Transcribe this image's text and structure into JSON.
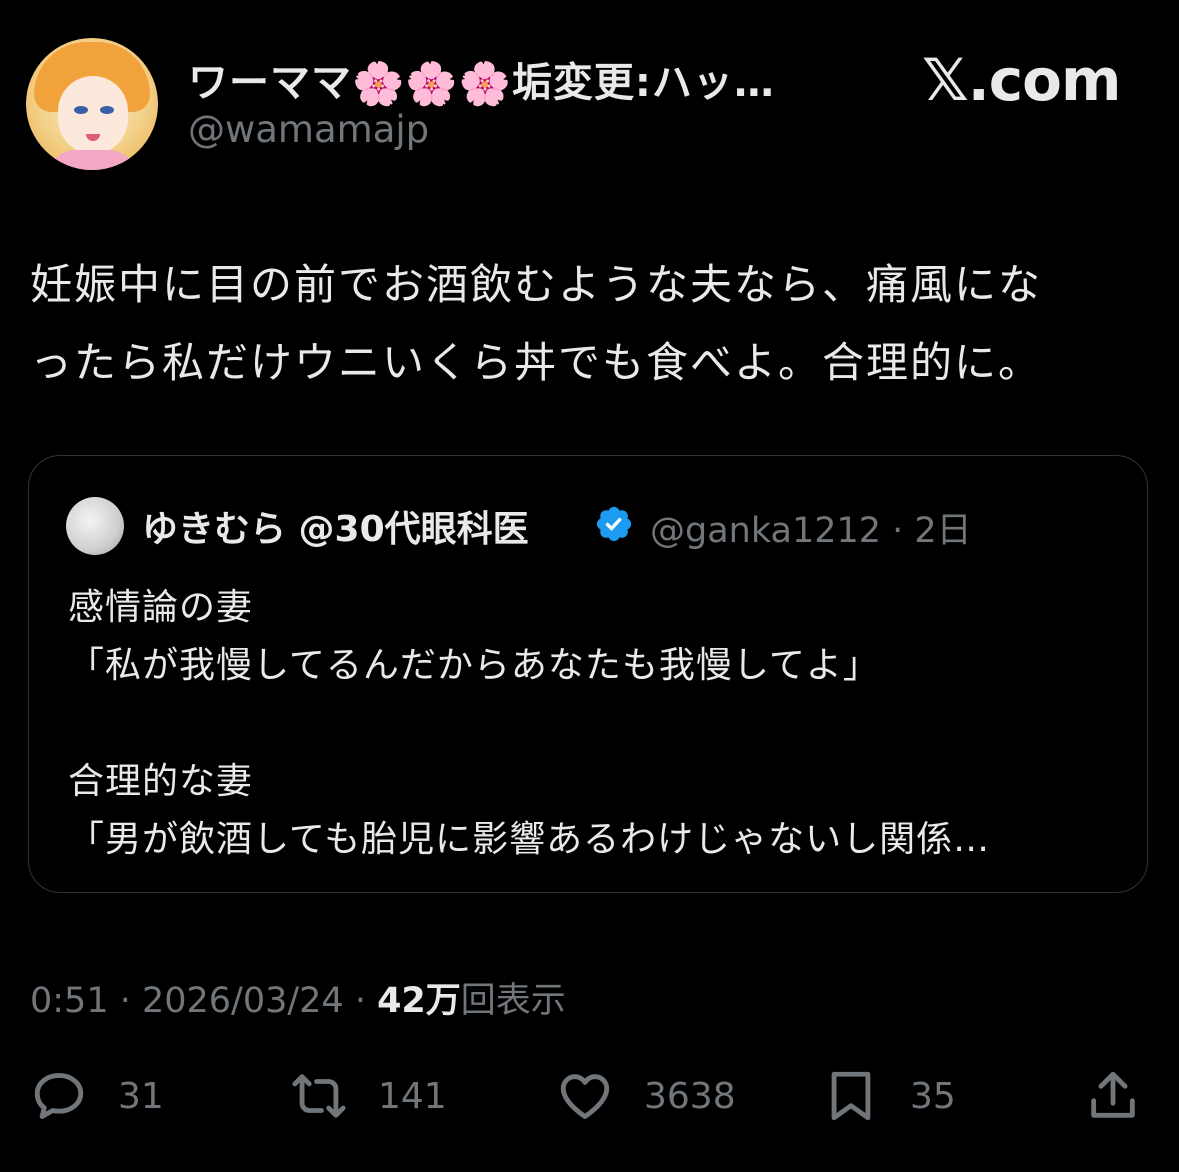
{
  "author": {
    "display_name_prefix": "ワーママ",
    "flowers": [
      "🌸",
      "🌸",
      "🌸"
    ],
    "display_name_suffix": "垢変更:ハッ…",
    "handle": "@wamamajp"
  },
  "brand": "𝕏.com",
  "tweet": {
    "lines": [
      "妊娠中に目の前でお酒飲むような夫なら、痛風にな",
      "ったら私だけウニいくら丼でも食べよ。合理的に。"
    ]
  },
  "quote": {
    "name": "ゆきむら @30代眼科医",
    "handle_time": "@ganka1212 · 2日",
    "lines": [
      "感情論の妻",
      "「私が我慢してるんだからあなたも我慢してよ」",
      "",
      "合理的な妻",
      "「男が飲酒しても胎児に影響あるわけじゃないし関係…"
    ]
  },
  "meta": {
    "time_date": "0:51 · 2026/03/24 · ",
    "views_count": "42万",
    "views_label": "回表示"
  },
  "actions": {
    "reply": "31",
    "repost": "141",
    "like": "3638",
    "bookmark": "35"
  },
  "colors": {
    "background": "#000000",
    "text": "#e7e9ea",
    "muted": "#71767b",
    "border": "#2f3336",
    "verified": "#1d9bf0"
  }
}
